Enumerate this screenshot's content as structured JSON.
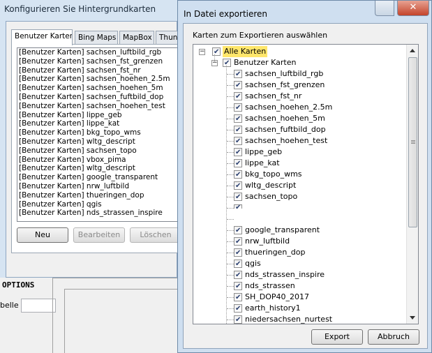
{
  "background_window": {
    "title": "Konfigurieren Sie Hintergrundkarten",
    "tabs": [
      "Benutzer Karten",
      "Bing Maps",
      "MapBox",
      "Thund"
    ],
    "map_list": [
      "[Benutzer Karten] sachsen_luftbild_rgb",
      "[Benutzer Karten] sachsen_fst_grenzen",
      "[Benutzer Karten] sachsen_fst_nr",
      "[Benutzer Karten] sachsen_hoehen_2.5m",
      "[Benutzer Karten] sachsen_hoehen_5m",
      "[Benutzer Karten] sachsen_fuftbild_dop",
      "[Benutzer Karten] sachsen_hoehen_test",
      "[Benutzer Karten] lippe_geb",
      "[Benutzer Karten] lippe_kat",
      "[Benutzer Karten] bkg_topo_wms",
      "[Benutzer Karten] wltg_descript",
      "[Benutzer Karten] sachsen_topo",
      "[Benutzer Karten] vbox_pima",
      "[Benutzer Karten] wltg_descript",
      "[Benutzer Karten] google_transparent",
      "[Benutzer Karten] nrw_luftbild",
      "[Benutzer Karten] thueringen_dop",
      "[Benutzer Karten] qgis",
      "[Benutzer Karten] nds_strassen_inspire"
    ],
    "buttons": {
      "new": "Neu",
      "edit": "Bearbeiten",
      "delete": "Löschen"
    },
    "lower_label": "OPTIONS",
    "lower_field_label": "belle"
  },
  "dialog": {
    "title": "In Datei exportieren",
    "close_glyph": "✕",
    "instruction": "Karten zum Exportieren auswählen",
    "tree": {
      "root": {
        "label": "Alle Karten",
        "expander": "−"
      },
      "group": {
        "label": "Benutzer Karten",
        "expander": "−"
      },
      "items": [
        "sachsen_luftbild_rgb",
        "sachsen_fst_grenzen",
        "sachsen_fst_nr",
        "sachsen_hoehen_2.5m",
        "sachsen_hoehen_5m",
        "sachsen_fuftbild_dop",
        "sachsen_hoehen_test",
        "lippe_geb",
        "lippe_kat",
        "bkg_topo_wms",
        "wltg_descript",
        "sachsen_topo",
        "",
        "",
        "google_transparent",
        "nrw_luftbild",
        "thueringen_dop",
        "qgis",
        "nds_strassen_inspire",
        "nds_strassen",
        "SH_DOP40_2017",
        "earth_history1",
        "niedersachsen_nurtest"
      ]
    },
    "buttons": {
      "export": "Export",
      "cancel": "Abbruch"
    }
  }
}
